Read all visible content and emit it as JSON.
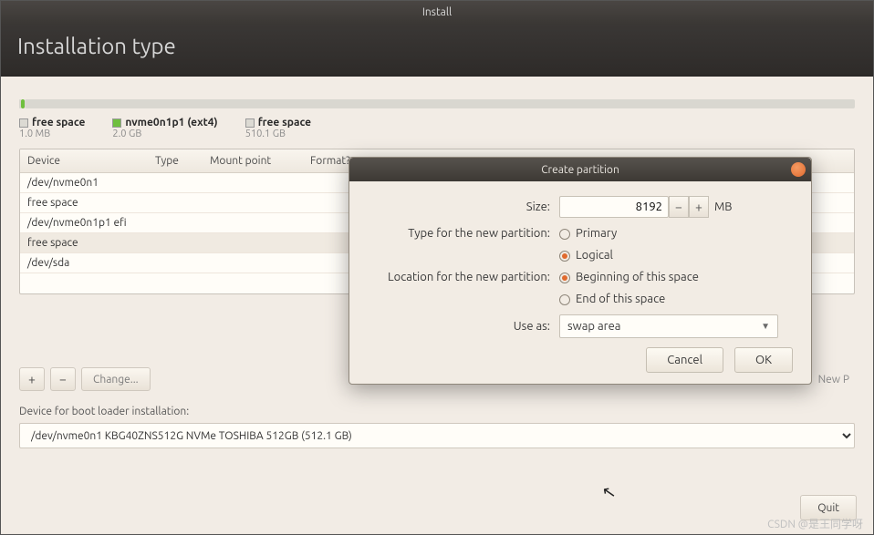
{
  "window": {
    "title": "Install"
  },
  "header": {
    "title": "Installation type"
  },
  "diskbar": {
    "legend": [
      {
        "label": "free space",
        "sub": "1.0 MB",
        "color": "#dcdad3"
      },
      {
        "label": "nvme0n1p1 (ext4)",
        "sub": "2.0 GB",
        "color": "#6fbf3e"
      },
      {
        "label": "free space",
        "sub": "510.1 GB",
        "color": "#dcdad3"
      }
    ]
  },
  "device_table": {
    "headers": [
      "Device",
      "Type",
      "Mount point",
      "Format?",
      ""
    ],
    "rows": [
      {
        "text": "/dev/nvme0n1"
      },
      {
        "text": "free space"
      },
      {
        "text": "/dev/nvme0n1p1  efi"
      },
      {
        "text": "free space",
        "alt": true
      },
      {
        "text": "/dev/sda"
      }
    ]
  },
  "toolbar": {
    "add": "+",
    "remove": "−",
    "change": "Change...",
    "new_partition_table": "New P"
  },
  "boot": {
    "label": "Device for boot loader installation:",
    "value": "/dev/nvme0n1    KBG40ZNS512G NVMe TOSHIBA 512GB (512.1 GB)"
  },
  "footer": {
    "quit": "Quit"
  },
  "dialog": {
    "title": "Create partition",
    "size_label": "Size:",
    "size_value": "8192",
    "size_unit": "MB",
    "type_label": "Type for the new partition:",
    "type_primary": "Primary",
    "type_logical": "Logical",
    "type_selected": "logical",
    "location_label": "Location for the new partition:",
    "location_beginning": "Beginning of this space",
    "location_end": "End of this space",
    "location_selected": "beginning",
    "useas_label": "Use as:",
    "useas_value": "swap area",
    "cancel": "Cancel",
    "ok": "OK"
  },
  "watermark": "CSDN @是王同学呀"
}
